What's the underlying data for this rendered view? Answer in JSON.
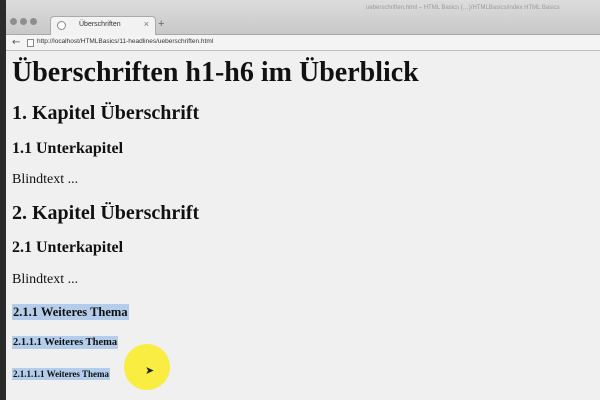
{
  "browser": {
    "window_title": "ueberschriften.html – HTML Basics (…)/HTMLBasics/index HTML Basics",
    "tab_title": "Überschriften",
    "tab_close": "×",
    "new_tab": "+",
    "back_button": "←",
    "url": "http://localhost/HTMLBasics/11-headlines/ueberschriften.html"
  },
  "page": {
    "h1": "Überschriften h1-h6 im Überblick",
    "h2_1": "1. Kapitel Überschrift",
    "h3_1": "1.1 Unterkapitel",
    "p_1": "Blindtext ...",
    "h2_2": "2. Kapitel Überschrift",
    "h3_2": "2.1 Unterkapitel",
    "p_2": "Blindtext ...",
    "h4": "2.1.1 Weiteres Thema",
    "h5": "2.1.1.1 Weiteres Thema",
    "h6": "2.1.1.1.1 Weiteres Thema"
  },
  "colors": {
    "selection": "#b4cdea",
    "cursor_highlight": "#f8ec36"
  }
}
